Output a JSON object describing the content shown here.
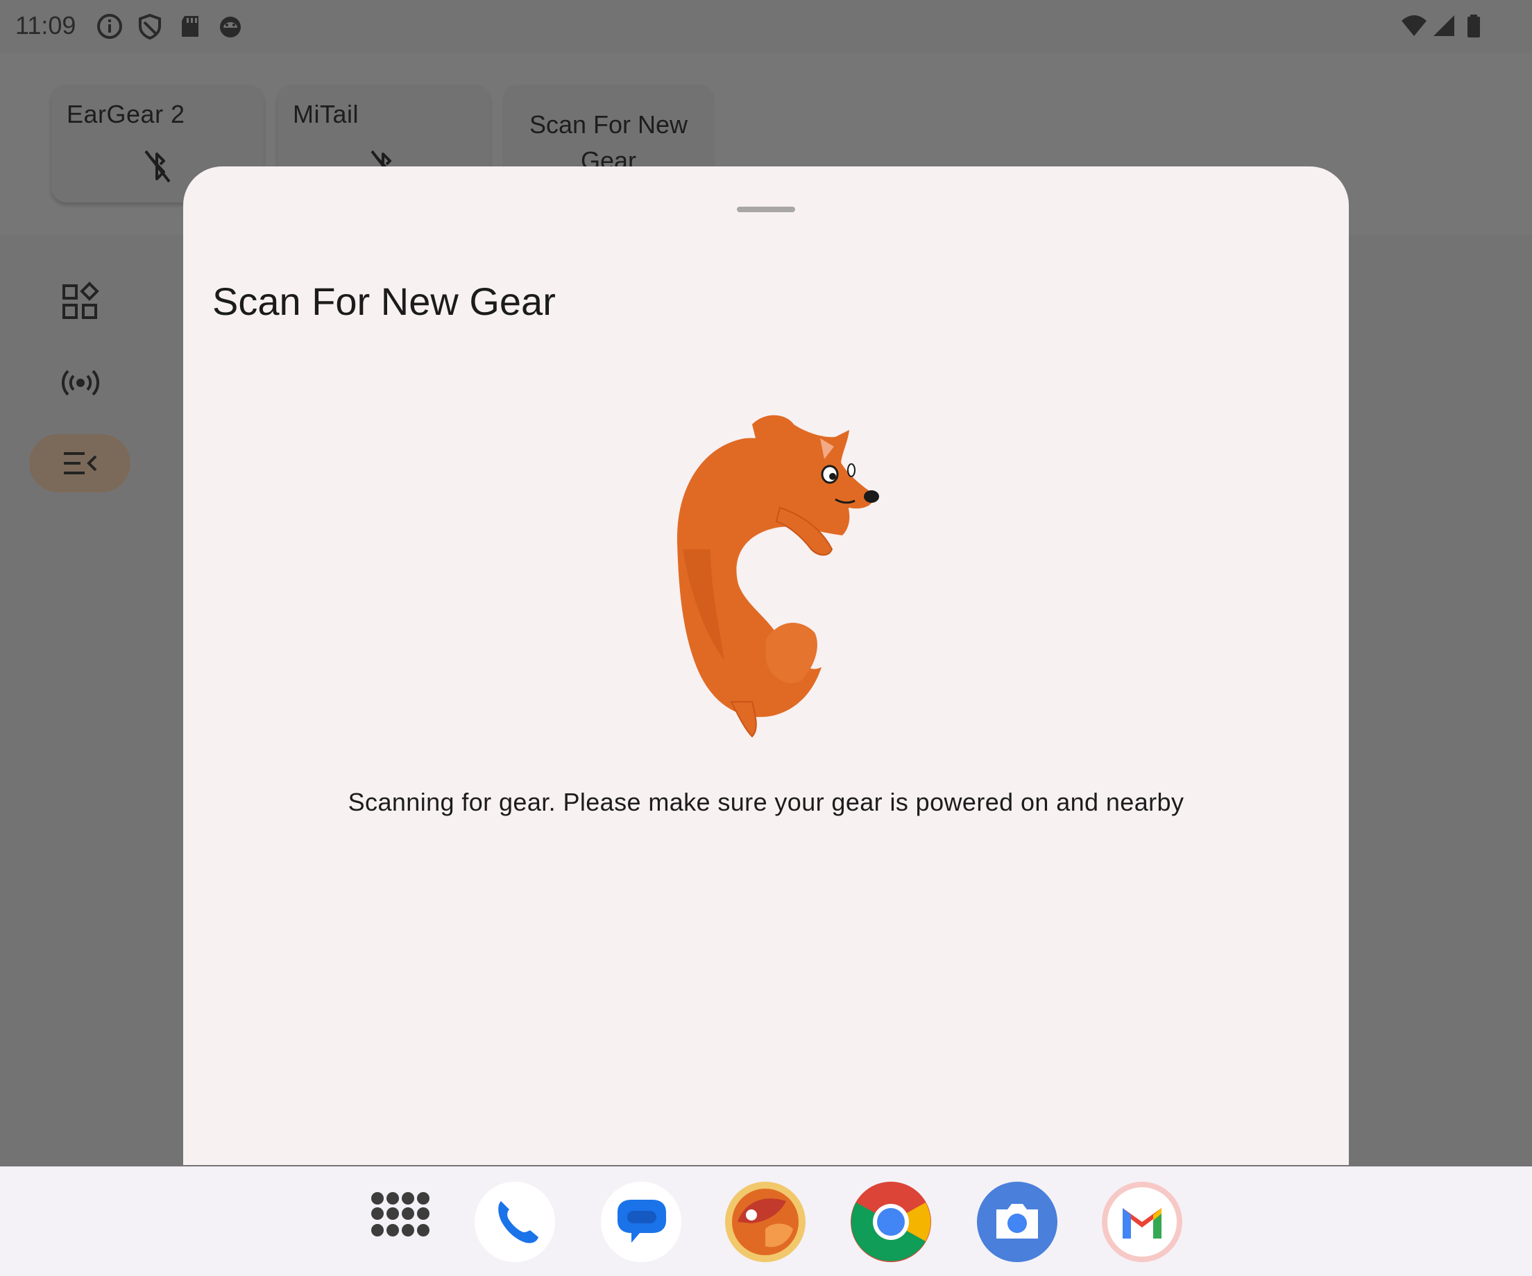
{
  "status_bar": {
    "time": "11:09",
    "left_icons": [
      "info-icon",
      "shield-icon",
      "sd-card-icon",
      "android-icon"
    ],
    "right_icons": [
      "wifi-icon",
      "signal-icon",
      "battery-icon"
    ]
  },
  "gear": {
    "items": [
      {
        "label": "EarGear 2",
        "icon": "bluetooth-disabled-icon"
      },
      {
        "label": "MiTail",
        "icon": "bluetooth-disabled-icon"
      }
    ],
    "scan_label": "Scan For New Gear"
  },
  "nav_rail": {
    "items": [
      {
        "icon": "widgets-icon"
      },
      {
        "icon": "broadcast-icon"
      },
      {
        "icon": "menu-open-icon",
        "active": true
      }
    ]
  },
  "sheet": {
    "title": "Scan For New Gear",
    "message": "Scanning for gear. Please make sure your gear is powered on and nearby",
    "illustration": "fox-illustration"
  },
  "dock": {
    "apps": [
      "app-drawer-icon",
      "phone-icon",
      "messages-icon",
      "tail-app-icon",
      "chrome-icon",
      "camera-icon",
      "gmail-icon"
    ]
  },
  "colors": {
    "scrim": "#747374",
    "sheet_bg": "#f7f1f2",
    "fox": "#e06a24",
    "active_rail": "#7b6a5a"
  }
}
